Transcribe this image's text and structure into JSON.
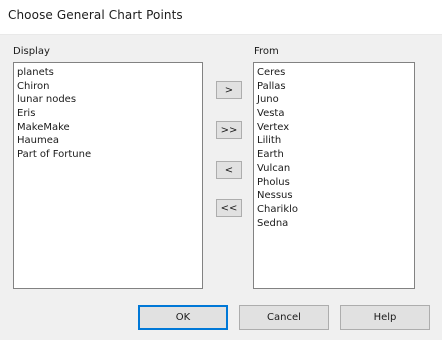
{
  "dialog": {
    "title": "Choose General Chart Points"
  },
  "display": {
    "label": "Display",
    "items": [
      "planets",
      "Chiron",
      "lunar nodes",
      "Eris",
      "MakeMake",
      "Haumea",
      "Part of Fortune"
    ]
  },
  "from": {
    "label": "From",
    "items": [
      "Ceres",
      "Pallas",
      "Juno",
      "Vesta",
      "Vertex",
      "Lilith",
      "Earth",
      "Vulcan",
      "Pholus",
      "Nessus",
      "Chariklo",
      "Sedna"
    ]
  },
  "move_buttons": {
    "add": ">",
    "add_all": ">>",
    "remove": "<",
    "remove_all": "<<"
  },
  "footer": {
    "ok": "OK",
    "cancel": "Cancel",
    "help": "Help"
  }
}
